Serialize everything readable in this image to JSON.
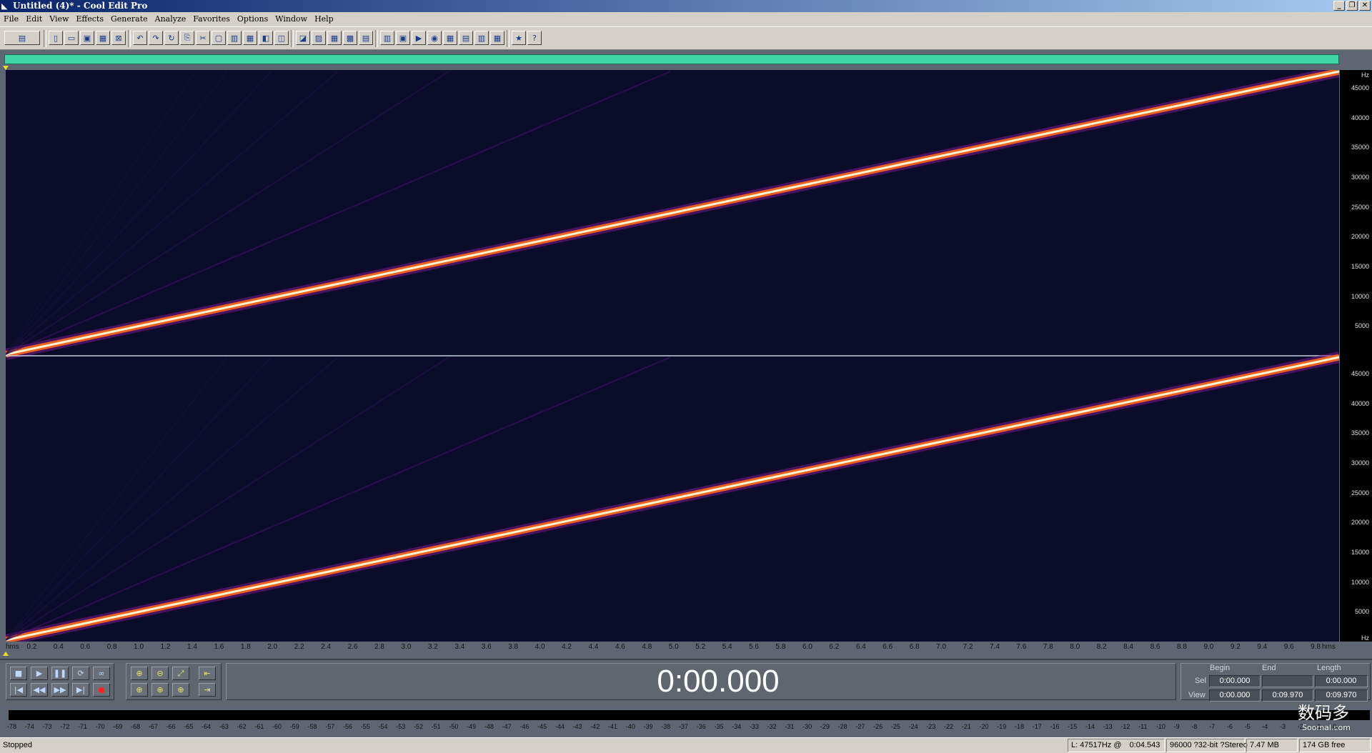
{
  "window": {
    "title": "Untitled (4)* - Cool Edit Pro",
    "controls": [
      "_",
      "❐",
      "✕"
    ]
  },
  "menu": [
    "File",
    "Edit",
    "View",
    "Effects",
    "Generate",
    "Analyze",
    "Favorites",
    "Options",
    "Window",
    "Help"
  ],
  "toolbar": {
    "icons": [
      "multitrack-toggle-icon",
      "new-file-icon",
      "open-file-icon",
      "save-icon",
      "save-all-icon",
      "close-icon",
      "undo-icon",
      "redo-icon",
      "repeat-last-icon",
      "copy-icon",
      "cut-icon",
      "paste-icon",
      "paste-new-icon",
      "mix-paste-icon",
      "trim-icon",
      "mute-icon",
      "spectral-view-icon",
      "waveform-view-icon",
      "grid-icon",
      "loop-icon",
      "show-cues-icon",
      "sample-format-icon",
      "time-format-icon",
      "play-list-icon",
      "scientific-filter-icon",
      "frequency-analysis-icon",
      "info-icon",
      "cd-tracks-icon",
      "settings-icon",
      "favorites-icon",
      "help-icon"
    ]
  },
  "spectrogram": {
    "hz_unit": "Hz",
    "hz_labels": [
      "45000",
      "40000",
      "35000",
      "30000",
      "25000",
      "20000",
      "15000",
      "10000",
      "5000"
    ],
    "channels": 2,
    "sweep_start_hz": 0,
    "sweep_end_hz": 48000
  },
  "ruler": {
    "unit": "hms",
    "ticks": [
      "0.2",
      "0.4",
      "0.6",
      "0.8",
      "1.0",
      "1.2",
      "1.4",
      "1.6",
      "1.8",
      "2.0",
      "2.2",
      "2.4",
      "2.6",
      "2.8",
      "3.0",
      "3.2",
      "3.4",
      "3.6",
      "3.8",
      "4.0",
      "4.2",
      "4.4",
      "4.6",
      "4.8",
      "5.0",
      "5.2",
      "5.4",
      "5.6",
      "5.8",
      "6.0",
      "6.2",
      "6.4",
      "6.6",
      "6.8",
      "7.0",
      "7.2",
      "7.4",
      "7.6",
      "7.8",
      "8.0",
      "8.2",
      "8.4",
      "8.6",
      "8.8",
      "9.0",
      "9.2",
      "9.4",
      "9.6",
      "9.8"
    ]
  },
  "transport": {
    "row1": [
      "■",
      "▶",
      "❚❚",
      "⟳",
      "∞"
    ],
    "row2": [
      "|◀",
      "◀◀",
      "▶▶",
      "▶|",
      "●"
    ],
    "zoom": [
      "⊕",
      "⊖",
      "⤢",
      "⇤",
      "⊕",
      "⊕",
      "⊕",
      "⇥"
    ],
    "clock": "0:00.000"
  },
  "selection": {
    "headers": {
      "begin": "Begin",
      "end": "End",
      "length": "Length"
    },
    "sel_label": "Sel",
    "view_label": "View",
    "sel": {
      "begin": "0:00.000",
      "end": "",
      "length": "0:00.000"
    },
    "view": {
      "begin": "0:00.000",
      "end": "0:09.970",
      "length": "0:09.970"
    }
  },
  "meter": {
    "db_labels": [
      "-78",
      "-74",
      "-73",
      "-72",
      "-71",
      "-70",
      "-69",
      "-68",
      "-67",
      "-66",
      "-65",
      "-64",
      "-63",
      "-62",
      "-61",
      "-60",
      "-59",
      "-58",
      "-57",
      "-56",
      "-55",
      "-54",
      "-53",
      "-52",
      "-51",
      "-50",
      "-49",
      "-48",
      "-47",
      "-46",
      "-45",
      "-44",
      "-43",
      "-42",
      "-41",
      "-40",
      "-39",
      "-38",
      "-37",
      "-36",
      "-35",
      "-34",
      "-33",
      "-32",
      "-31",
      "-30",
      "-29",
      "-28",
      "-27",
      "-26",
      "-25",
      "-24",
      "-23",
      "-22",
      "-21",
      "-20",
      "-19",
      "-18",
      "-17",
      "-16",
      "-15",
      "-14",
      "-13",
      "-12",
      "-11",
      "-10",
      "-9",
      "-8",
      "-7",
      "-6",
      "-5",
      "-4",
      "-3",
      "-2",
      "-1",
      "0"
    ]
  },
  "status": {
    "state": "Stopped",
    "cursor_freq": "L: 47517Hz @",
    "cursor_time": "0:04.543",
    "format": "96000 ?32-bit ?Stereo",
    "size": "7.47 MB",
    "free": "174 GB free"
  },
  "watermark": {
    "cn": "数码多",
    "url": "Soomal.com"
  },
  "colors": {
    "spectrogram_bg": "#0b0c2a",
    "sweep_core": "#fff6d0",
    "sweep_glow": "#ff7a1a",
    "overview": "#3fd6a5",
    "chrome": "#d4d0c8",
    "transport_bg": "#60666f"
  }
}
